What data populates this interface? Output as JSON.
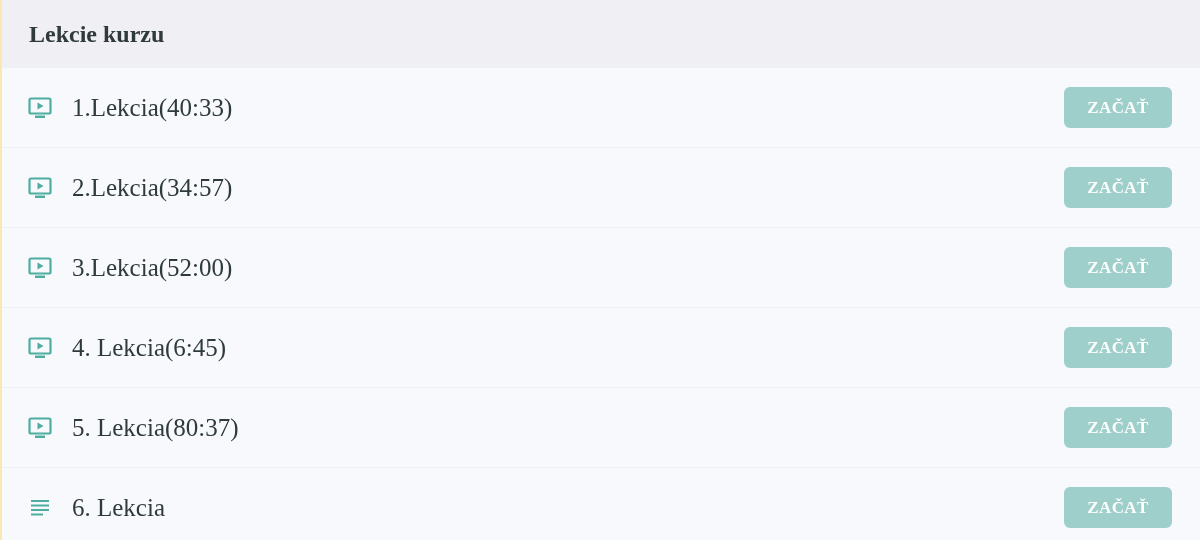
{
  "panel": {
    "title": "Lekcie kurzu"
  },
  "lessons": [
    {
      "kind": "video",
      "title": "1.Lekcia(40:33)",
      "button": "ZAČAŤ"
    },
    {
      "kind": "video",
      "title": "2.Lekcia(34:57)",
      "button": "ZAČAŤ"
    },
    {
      "kind": "video",
      "title": "3.Lekcia(52:00)",
      "button": "ZAČAŤ"
    },
    {
      "kind": "video",
      "title": "4. Lekcia(6:45)",
      "button": "ZAČAŤ"
    },
    {
      "kind": "video",
      "title": "5. Lekcia(80:37)",
      "button": "ZAČAŤ"
    },
    {
      "kind": "text",
      "title": "6. Lekcia",
      "button": "ZAČAŤ"
    }
  ]
}
